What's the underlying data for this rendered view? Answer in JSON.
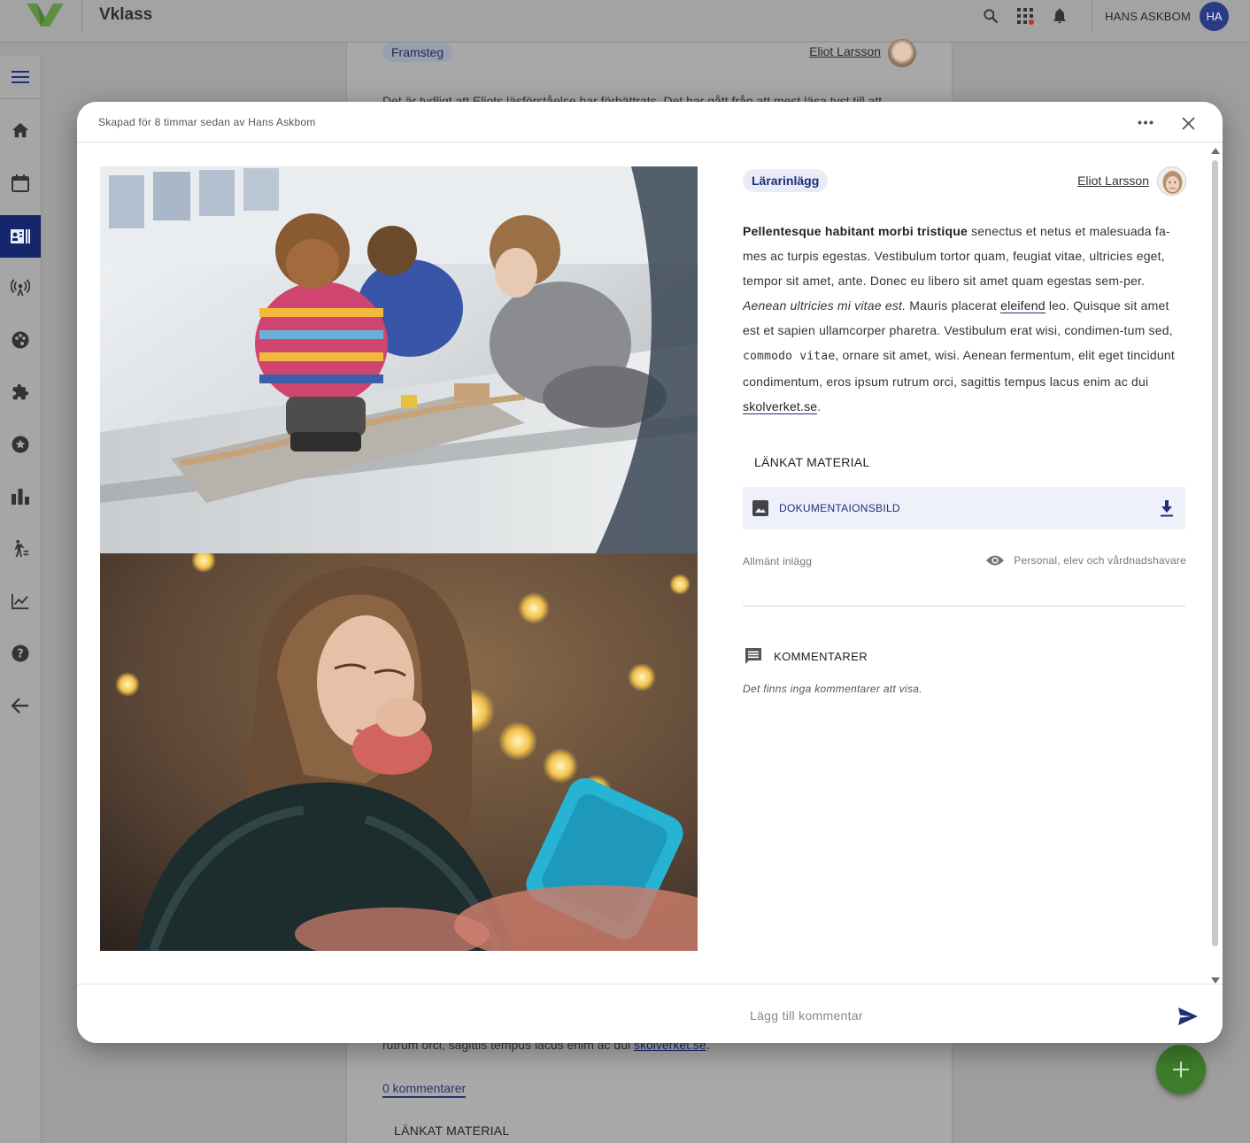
{
  "app": {
    "brand": "Vklass",
    "user_name": "HANS ASKBOM",
    "user_initials": "HA",
    "accent": "#1f2f76",
    "brand_green": "#6aa84f"
  },
  "topbar": {
    "icons": [
      "search-icon",
      "apps-grid-icon",
      "notifications-icon"
    ]
  },
  "sidebar": {
    "items": [
      {
        "icon": "menu-icon"
      },
      {
        "icon": "home-icon"
      },
      {
        "icon": "calendar-icon"
      },
      {
        "icon": "journal-icon",
        "active": true
      },
      {
        "icon": "broadcast-icon"
      },
      {
        "icon": "palette-icon"
      },
      {
        "icon": "puzzle-icon"
      },
      {
        "icon": "star-badge-icon"
      },
      {
        "icon": "bar-chart-icon"
      },
      {
        "icon": "progress-walker-icon"
      },
      {
        "icon": "trend-chart-icon"
      },
      {
        "icon": "help-icon"
      },
      {
        "icon": "back-arrow-icon"
      }
    ]
  },
  "background": {
    "tag": "Framsteg",
    "author": "Eliot Larsson",
    "text_top": "Det är tydligt att Eliots läsförståelse har förbättrats. Det har gått från att mest läsa tyst till att",
    "text_bottom_pre": "rutrum orci, sagittis tempus lacus enim ac dui ",
    "text_bottom_link": "skolverket.se",
    "text_bottom_post": ".",
    "comments_link": "0 kommentarer",
    "linked_title": "LÄNKAT MATERIAL"
  },
  "modal": {
    "created": "Skapad för 8 timmar sedan av Hans Askbom",
    "tag": "Lärarinlägg",
    "author": "Eliot Larsson",
    "body": {
      "bold": "Pellentesque habitant morbi tristique",
      "t1": " senectus et netus et malesuada fa-mes ac turpis egestas. Vestibulum tortor quam, feugiat vitae, ultricies eget, tempor sit amet, ante. Donec eu libero sit amet quam egestas sem-per. ",
      "italic": "Aenean ultricies mi vitae est.",
      "t2": " Mauris placerat ",
      "link1": "eleifend",
      "t3": " leo. Quisque sit amet est et sapien ullamcorper pharetra. Vestibulum erat wisi, condimen-tum sed, ",
      "code": "commodo vitae",
      "t4": ", ornare sit amet, wisi. Aenean fermentum, elit eget tincidunt condimentum, eros ipsum rutrum orci, sagittis tempus lacus enim ac dui ",
      "link2": "skolverket.se",
      "t5": "."
    },
    "linked_title": "LÄNKAT MATERIAL",
    "linked_item": "DOKUMENTAIONSBILD",
    "visibility_type": "Allmänt inlägg",
    "visibility_audience": "Personal, elev och vårdnadshavare",
    "comments_title": "KOMMENTARER",
    "no_comments": "Det finns inga kommentarer att visa.",
    "comment_placeholder": "Lägg till kommentar"
  }
}
